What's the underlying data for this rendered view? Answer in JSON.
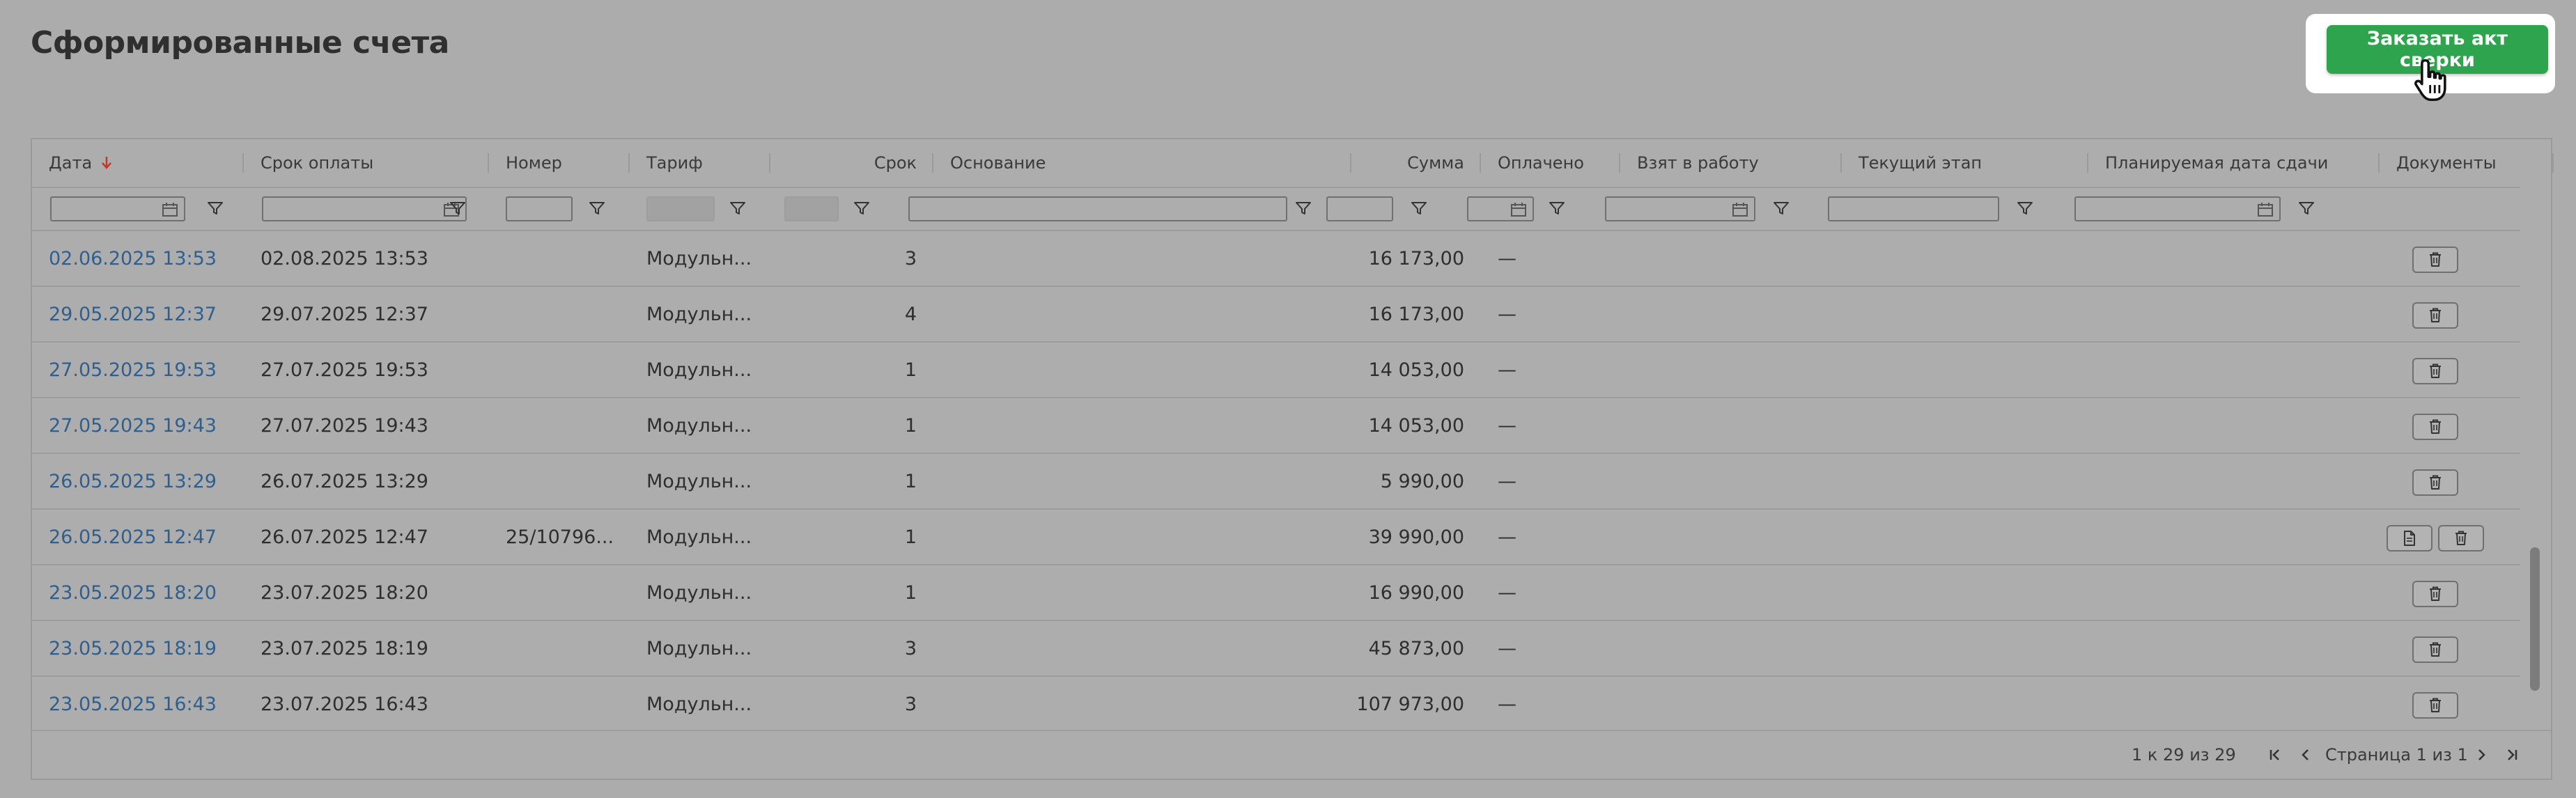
{
  "page": {
    "title": "Сформированные счета"
  },
  "action": {
    "order_label": "Заказать акт сверки"
  },
  "colors": {
    "accent": "#2ea44f",
    "link": "#2f5f8f"
  },
  "table": {
    "columns": {
      "date": "Дата",
      "due": "Срок оплаты",
      "number": "Номер",
      "tariff": "Тариф",
      "term": "Срок",
      "basis": "Основание",
      "amount": "Сумма",
      "paid": "Оплачено",
      "taken": "Взят в работу",
      "stage": "Текущий этап",
      "planned": "Планируемая дата сдачи",
      "docs": "Документы"
    },
    "sort": {
      "column": "date",
      "direction": "desc"
    },
    "rows": [
      {
        "date": "02.06.2025 13:53",
        "due": "02.08.2025 13:53",
        "number": "",
        "tariff": "Модульн...",
        "term": "3",
        "amount": "16 173,00",
        "paid": "—",
        "docs": [
          "trash-icon"
        ]
      },
      {
        "date": "29.05.2025 12:37",
        "due": "29.07.2025 12:37",
        "number": "",
        "tariff": "Модульн...",
        "term": "4",
        "amount": "16 173,00",
        "paid": "—",
        "docs": [
          "trash-icon"
        ]
      },
      {
        "date": "27.05.2025 19:53",
        "due": "27.07.2025 19:53",
        "number": "",
        "tariff": "Модульн...",
        "term": "1",
        "amount": "14 053,00",
        "paid": "—",
        "docs": [
          "trash-icon"
        ]
      },
      {
        "date": "27.05.2025 19:43",
        "due": "27.07.2025 19:43",
        "number": "",
        "tariff": "Модульн...",
        "term": "1",
        "amount": "14 053,00",
        "paid": "—",
        "docs": [
          "trash-icon"
        ]
      },
      {
        "date": "26.05.2025 13:29",
        "due": "26.07.2025 13:29",
        "number": "",
        "tariff": "Модульн...",
        "term": "1",
        "amount": "5 990,00",
        "paid": "—",
        "docs": [
          "trash-icon"
        ]
      },
      {
        "date": "26.05.2025 12:47",
        "due": "26.07.2025 12:47",
        "number": "25/10796...",
        "tariff": "Модульн...",
        "term": "1",
        "amount": "39 990,00",
        "paid": "—",
        "docs": [
          "document-icon",
          "trash-icon"
        ]
      },
      {
        "date": "23.05.2025 18:20",
        "due": "23.07.2025 18:20",
        "number": "",
        "tariff": "Модульн...",
        "term": "1",
        "amount": "16 990,00",
        "paid": "—",
        "docs": [
          "trash-icon"
        ]
      },
      {
        "date": "23.05.2025 18:19",
        "due": "23.07.2025 18:19",
        "number": "",
        "tariff": "Модульн...",
        "term": "3",
        "amount": "45 873,00",
        "paid": "—",
        "docs": [
          "trash-icon"
        ]
      },
      {
        "date": "23.05.2025 16:43",
        "due": "23.07.2025 16:43",
        "number": "",
        "tariff": "Модульн...",
        "term": "3",
        "amount": "107 973,00",
        "paid": "—",
        "docs": [
          "trash-icon"
        ]
      }
    ]
  },
  "pager": {
    "info": "1 к 29 из 29",
    "page_label": "Страница 1 из 1"
  }
}
